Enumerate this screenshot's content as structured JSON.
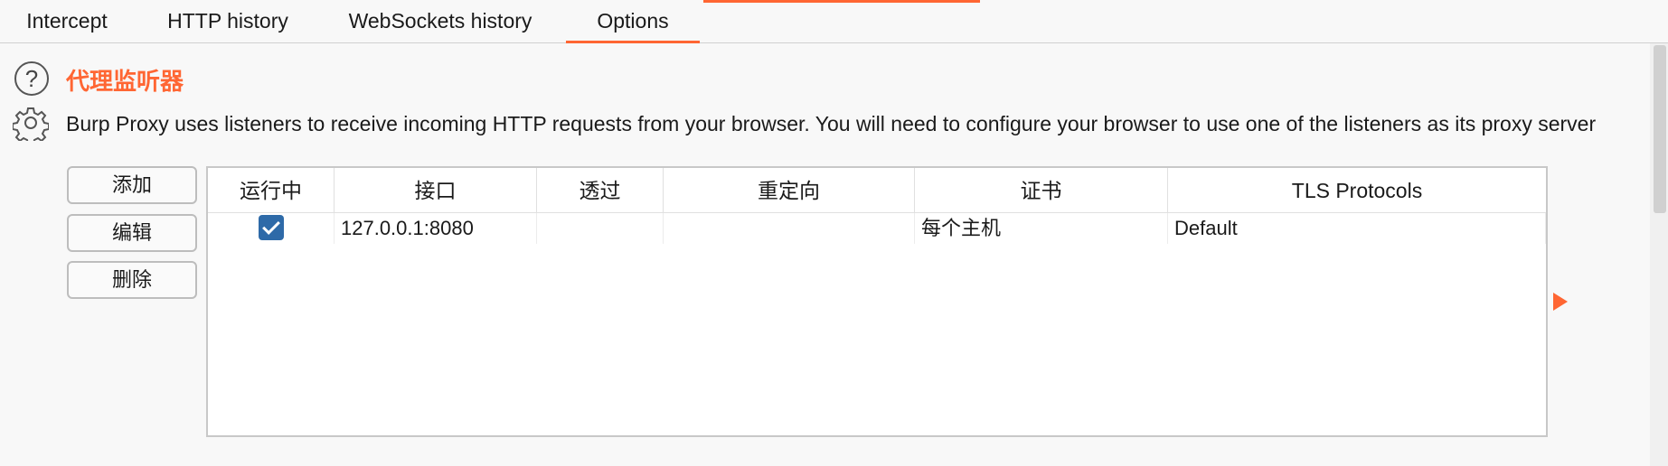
{
  "tabs": [
    {
      "label": "Intercept",
      "active": false
    },
    {
      "label": "HTTP history",
      "active": false
    },
    {
      "label": "WebSockets history",
      "active": false
    },
    {
      "label": "Options",
      "active": true
    }
  ],
  "colors": {
    "accent": "#ff6633",
    "checkbox": "#2e6aa8"
  },
  "section": {
    "title": "代理监听器",
    "description": "Burp Proxy uses listeners to receive incoming HTTP requests from your browser. You will need to configure your browser to use one of the listeners as its proxy server"
  },
  "buttons": {
    "add": "添加",
    "edit": "编辑",
    "remove": "删除"
  },
  "table": {
    "headers": [
      "运行中",
      "接口",
      "透过",
      "重定向",
      "证书",
      "TLS Protocols"
    ],
    "rows": [
      {
        "running": true,
        "interface": "127.0.0.1:8080",
        "invisible": "",
        "redirect": "",
        "certificate": "每个主机",
        "tls": "Default"
      }
    ]
  },
  "icons": {
    "help": "help-icon",
    "settings": "gear-icon",
    "expand": "expand-arrow-icon"
  }
}
